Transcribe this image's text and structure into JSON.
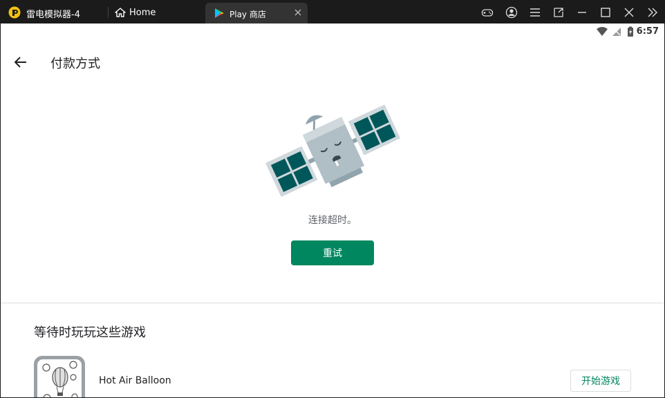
{
  "titlebar": {
    "app_title": "雷电模拟器-4",
    "home_tab_label": "Home",
    "play_tab_label": "Play 商店"
  },
  "status": {
    "time": "6:57"
  },
  "header": {
    "title": "付款方式"
  },
  "error": {
    "message": "连接超时。",
    "retry_label": "重试"
  },
  "suggestions": {
    "title": "等待时玩玩这些游戏",
    "items": [
      {
        "name": "Hot Air Balloon",
        "action_label": "开始游戏"
      }
    ]
  },
  "colors": {
    "accent": "#01875f",
    "titlebar": "#1b1b1b",
    "satellite_panel": "#00575a",
    "satellite_body": "#b0bec5"
  }
}
